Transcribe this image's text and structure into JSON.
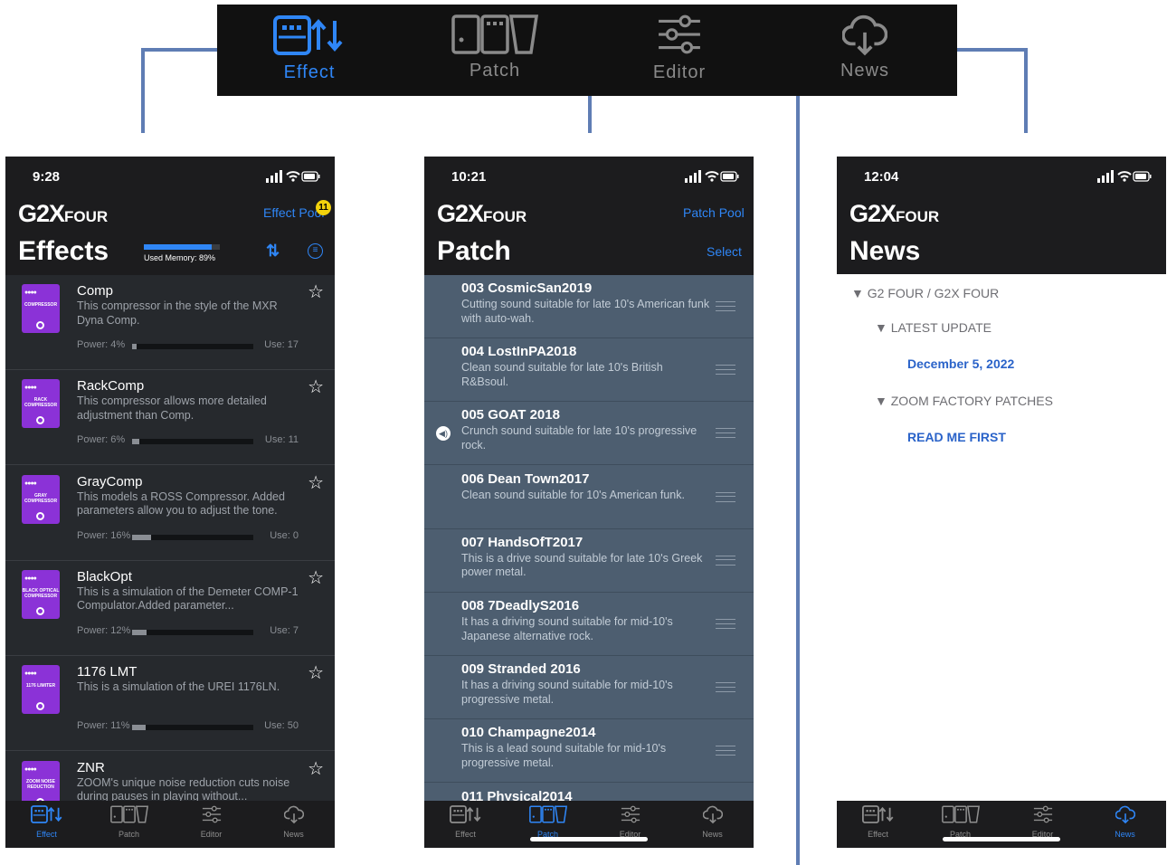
{
  "top_tabs": [
    {
      "label": "Effect",
      "icon": "effect-icon",
      "active": true
    },
    {
      "label": "Patch",
      "icon": "patch-icon",
      "active": false
    },
    {
      "label": "Editor",
      "icon": "editor-sliders-icon",
      "active": false
    },
    {
      "label": "News",
      "icon": "cloud-download-icon",
      "active": false
    }
  ],
  "bottom_tabs": [
    "Effect",
    "Patch",
    "Editor",
    "News"
  ],
  "effects_screen": {
    "time": "9:28",
    "logo_main": "G2X",
    "logo_sub": "FOUR",
    "link": "Effect Pool",
    "badge": "11",
    "title": "Effects",
    "memory_label": "Used Memory: 89%",
    "memory_pct": 89,
    "effects": [
      {
        "name": "Comp",
        "desc": "This compressor in the style of the MXR Dyna Comp.",
        "power": "Power: 4%",
        "power_pct": 4,
        "use": "Use: 17",
        "pedal": "COMPRESSOR"
      },
      {
        "name": "RackComp",
        "desc": "This compressor allows more detailed adjustment than Comp.",
        "power": "Power: 6%",
        "power_pct": 6,
        "use": "Use: 11",
        "pedal": "RACK COMPRESSOR"
      },
      {
        "name": "GrayComp",
        "desc": "This models a ROSS Compressor. Added parameters allow you to adjust the tone.",
        "power": "Power: 16%",
        "power_pct": 16,
        "use": "Use: 0",
        "pedal": "GRAY COMPRESSOR"
      },
      {
        "name": "BlackOpt",
        "desc": "This is a simulation of the Demeter COMP-1 Compulator.Added parameter...",
        "power": "Power: 12%",
        "power_pct": 12,
        "use": "Use: 7",
        "pedal": "BLACK OPTICAL COMPRESSOR"
      },
      {
        "name": "1176 LMT",
        "desc": "This is a simulation of the UREI 1176LN.",
        "power": "Power: 11%",
        "power_pct": 11,
        "use": "Use: 50",
        "pedal": "1176 LIMITER"
      },
      {
        "name": "ZNR",
        "desc": "ZOOM's unique noise reduction cuts noise during pauses in playing without...",
        "power": "",
        "power_pct": 0,
        "use": "",
        "pedal": "ZOOM NOISE REDUCTION"
      }
    ]
  },
  "patch_screen": {
    "time": "10:21",
    "logo_main": "G2X",
    "logo_sub": "FOUR",
    "link": "Patch Pool",
    "title": "Patch",
    "select": "Select",
    "patches": [
      {
        "name": "003 CosmicSan2019",
        "desc": "Cutting sound suitable for late 10's American funk with auto-wah."
      },
      {
        "name": "004 LostInPA2018",
        "desc": "Clean sound suitable for late 10's British R&Bsoul."
      },
      {
        "name": "005 GOAT 2018",
        "desc": "Crunch sound suitable for late 10's progressive rock.",
        "playing": true
      },
      {
        "name": "006 Dean Town2017",
        "desc": "Clean sound suitable for 10's American funk."
      },
      {
        "name": "007 HandsOfT2017",
        "desc": "This is a drive sound suitable for late 10's Greek power metal."
      },
      {
        "name": "008 7DeadlyS2016",
        "desc": "It has a driving sound suitable for mid-10's Japanese alternative rock."
      },
      {
        "name": "009 Stranded 2016",
        "desc": "It has a driving sound suitable for mid-10's progressive metal."
      },
      {
        "name": "010 Champagne2014",
        "desc": "This is a lead sound suitable for mid-10's progressive metal."
      },
      {
        "name": "011 Physical2014",
        "desc": ""
      }
    ]
  },
  "news_screen": {
    "time": "12:04",
    "logo_main": "G2X",
    "logo_sub": "FOUR",
    "title": "News",
    "tree": {
      "root": "G2 FOUR / G2X FOUR",
      "latest": "LATEST UPDATE",
      "latest_link": "December 5, 2022",
      "factory": "ZOOM FACTORY PATCHES",
      "factory_link": "READ ME FIRST"
    }
  },
  "colors": {
    "accent": "#2f86f6",
    "connector": "#5f7db4",
    "pedal": "#8b32d7",
    "patch_row": "#4d5e70",
    "news_link": "#2a63c9"
  }
}
